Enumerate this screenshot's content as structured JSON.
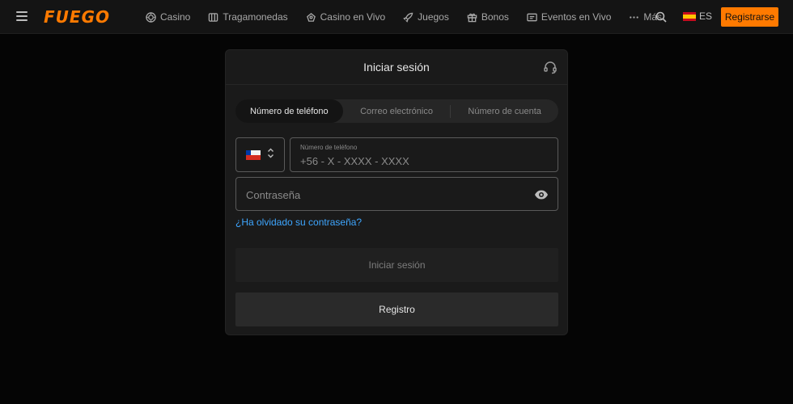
{
  "brand": {
    "logo_text": "FUEGO",
    "accent_color": "#ff7a00"
  },
  "nav": {
    "items": [
      {
        "label": "Casino",
        "icon": "casino-chip-icon"
      },
      {
        "label": "Tragamonedas",
        "icon": "slot-machine-icon"
      },
      {
        "label": "Casino en Vivo",
        "icon": "live-casino-icon"
      },
      {
        "label": "Juegos",
        "icon": "rocket-icon"
      },
      {
        "label": "Bonos",
        "icon": "gift-icon"
      },
      {
        "label": "Eventos en Vivo",
        "icon": "tv-icon"
      },
      {
        "label": "Más",
        "icon": "more-dots-icon"
      }
    ]
  },
  "header": {
    "language": "ES",
    "register_label": "Registrarse"
  },
  "login": {
    "title": "Iniciar sesión",
    "tabs": [
      {
        "label": "Número de teléfono",
        "active": true
      },
      {
        "label": "Correo electrónico",
        "active": false
      },
      {
        "label": "Número de cuenta",
        "active": false
      }
    ],
    "phone": {
      "label": "Número de teléfono",
      "placeholder": "+56 - X - XXXX - XXXX"
    },
    "password": {
      "placeholder": "Contraseña"
    },
    "forgot_label": "¿Ha olvidado su contraseña?",
    "submit_label": "Iniciar sesión",
    "register_label": "Registro"
  }
}
